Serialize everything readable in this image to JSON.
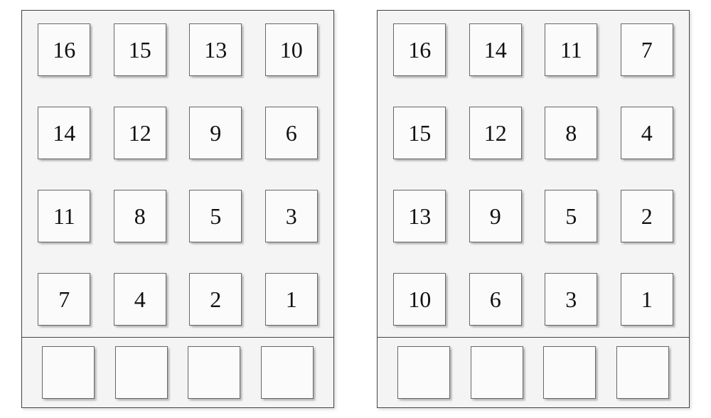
{
  "panels": [
    {
      "id": "left",
      "grid": [
        [
          "16",
          "15",
          "13",
          "10"
        ],
        [
          "14",
          "12",
          "9",
          "6"
        ],
        [
          "11",
          "8",
          "5",
          "3"
        ],
        [
          "7",
          "4",
          "2",
          "1"
        ]
      ],
      "bottom_slots": 4
    },
    {
      "id": "right",
      "grid": [
        [
          "16",
          "14",
          "11",
          "7"
        ],
        [
          "15",
          "12",
          "8",
          "4"
        ],
        [
          "13",
          "9",
          "5",
          "2"
        ],
        [
          "10",
          "6",
          "3",
          "1"
        ]
      ],
      "bottom_slots": 4
    }
  ]
}
